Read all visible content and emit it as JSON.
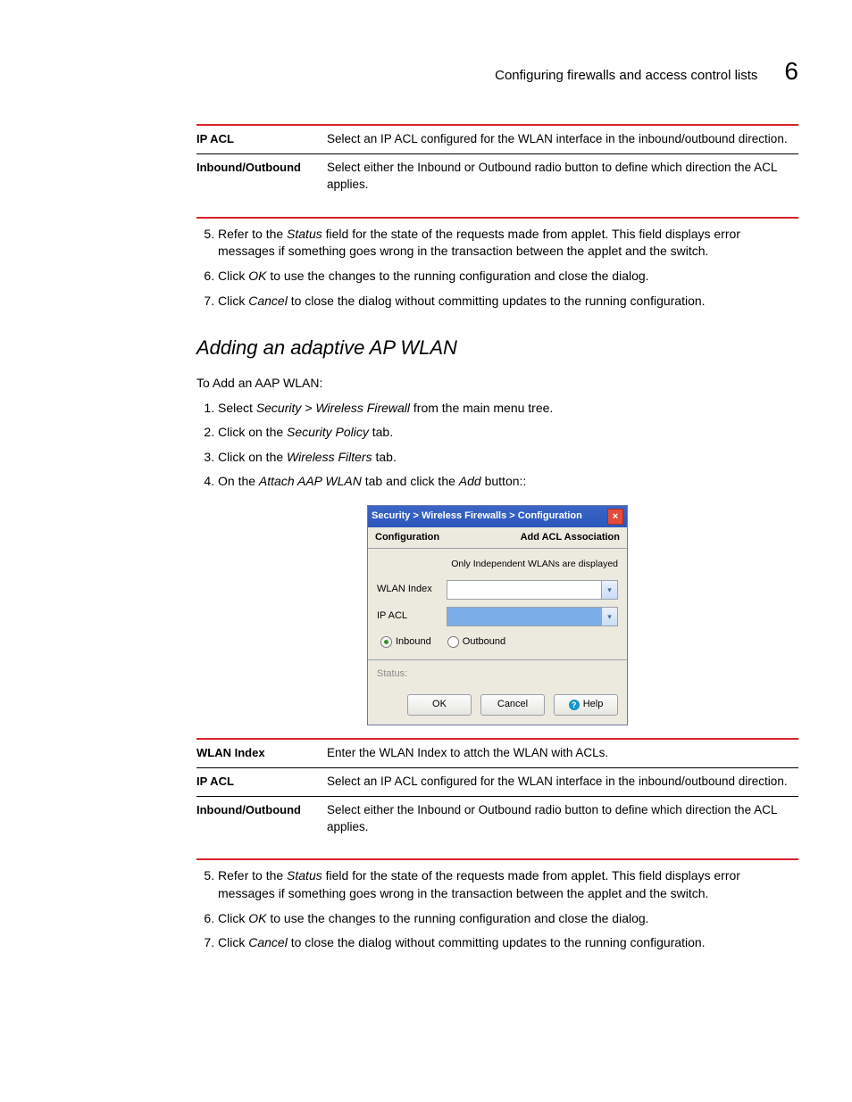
{
  "header": {
    "title": "Configuring firewalls and access control lists",
    "chapter": "6"
  },
  "table1": {
    "rows": [
      {
        "term": "IP ACL",
        "def": "Select an IP ACL configured for the WLAN interface in the inbound/outbound direction."
      },
      {
        "term": "Inbound/Outbound",
        "def": "Select either the Inbound or Outbound radio button to define which direction the ACL applies."
      }
    ]
  },
  "steps_a": [
    "Refer to the Status field for the state of the requests made from applet. This field displays error messages if something goes wrong in the transaction between the applet and the switch.",
    "Click OK to use the changes to the running configuration and close the dialog.",
    "Click Cancel to close the dialog without committing updates to the running configuration."
  ],
  "section": {
    "heading": "Adding an adaptive AP WLAN",
    "intro": "To Add an AAP WLAN:"
  },
  "steps_main": [
    "Select Security > Wireless Firewall from the main menu tree.",
    "Click on the Security Policy tab.",
    "Click on the Wireless Filters tab.",
    "On the Attach AAP WLAN tab and click the Add button::"
  ],
  "dialog": {
    "title": "Security > Wireless Firewalls > Configuration",
    "tab_left": "Configuration",
    "tab_right": "Add ACL Association",
    "hint": "Only Independent WLANs are displayed",
    "fields": [
      {
        "label": "WLAN Index"
      },
      {
        "label": "IP ACL"
      }
    ],
    "radio": {
      "inbound": "Inbound",
      "outbound": "Outbound",
      "selected": "Inbound"
    },
    "status_label": "Status:",
    "buttons": {
      "ok": "OK",
      "cancel": "Cancel",
      "help": "Help"
    }
  },
  "table2": {
    "rows": [
      {
        "term": "WLAN Index",
        "def": "Enter the WLAN Index to attch the WLAN with ACLs."
      },
      {
        "term": "IP ACL",
        "def": "Select an IP ACL configured for the WLAN interface in the inbound/outbound direction."
      },
      {
        "term": "Inbound/Outbound",
        "def": "Select either the Inbound or Outbound radio button to define which direction the ACL applies."
      }
    ]
  },
  "steps_b": [
    "Refer to the Status field for the state of the requests made from applet. This field displays error messages if something goes wrong in the transaction between the applet and the switch.",
    "Click OK to use the changes to the running configuration and close the dialog.",
    "Click Cancel to close the dialog without committing updates to the running configuration."
  ]
}
